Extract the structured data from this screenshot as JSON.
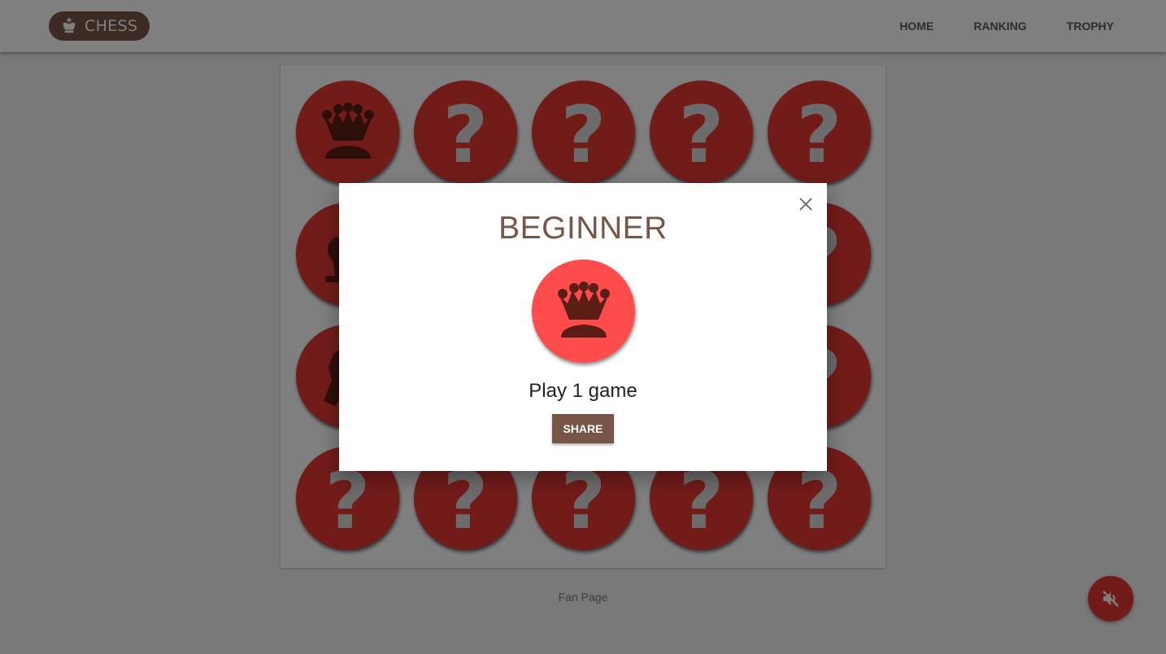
{
  "header": {
    "brand": "CHESS",
    "brand_icon": "chess-king-icon",
    "nav": [
      "HOME",
      "RANKING",
      "TROPHY"
    ]
  },
  "board": {
    "cells": [
      {
        "icon": "chess-queen-icon",
        "unlocked": true
      },
      {
        "icon": "question-mark-icon",
        "unlocked": false
      },
      {
        "icon": "question-mark-icon",
        "unlocked": false
      },
      {
        "icon": "question-mark-icon",
        "unlocked": false
      },
      {
        "icon": "question-mark-icon",
        "unlocked": false
      },
      {
        "icon": "chess-pawn-icon",
        "unlocked": true
      },
      {
        "icon": "question-mark-icon",
        "unlocked": false
      },
      {
        "icon": "question-mark-icon",
        "unlocked": false
      },
      {
        "icon": "question-mark-icon",
        "unlocked": false
      },
      {
        "icon": "question-mark-icon",
        "unlocked": false
      },
      {
        "icon": "chess-knight-icon",
        "unlocked": true
      },
      {
        "icon": "question-mark-icon",
        "unlocked": false
      },
      {
        "icon": "question-mark-icon",
        "unlocked": false
      },
      {
        "icon": "question-mark-icon",
        "unlocked": false
      },
      {
        "icon": "question-mark-icon",
        "unlocked": false
      },
      {
        "icon": "question-mark-icon",
        "unlocked": false
      },
      {
        "icon": "question-mark-icon",
        "unlocked": false
      },
      {
        "icon": "question-mark-icon",
        "unlocked": false
      },
      {
        "icon": "question-mark-icon",
        "unlocked": false
      },
      {
        "icon": "question-mark-icon",
        "unlocked": false
      }
    ]
  },
  "footer": {
    "link": "Fan Page"
  },
  "sound_button": {
    "icon": "volume-off-icon"
  },
  "modal": {
    "title": "BEGINNER",
    "badge_icon": "chess-queen-icon",
    "description": "Play 1 game",
    "share_label": "SHARE",
    "close_icon": "close-icon"
  },
  "colors": {
    "brand": "#795548",
    "trophy_red": "#e53935",
    "badge_red": "#ff4d4d",
    "piece_dark": "#5a1e14",
    "question_gray": "#d9d9d9"
  }
}
